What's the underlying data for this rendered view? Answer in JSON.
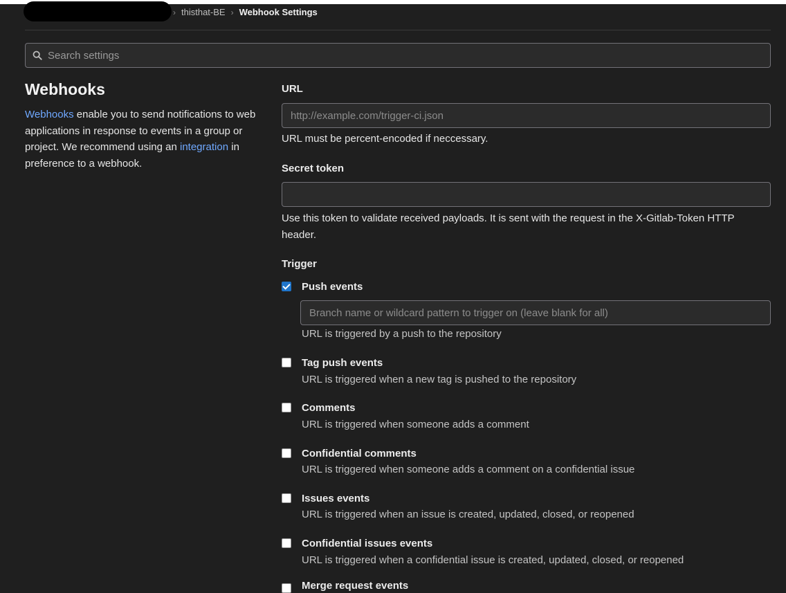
{
  "breadcrumb": {
    "project": "thisthat-BE",
    "current": "Webhook Settings"
  },
  "search": {
    "placeholder": "Search settings"
  },
  "intro": {
    "title": "Webhooks",
    "link_webhooks": "Webhooks",
    "text1": " enable you to send notifications to web applications in response to events in a group or project. We recommend using an ",
    "link_integration": "integration",
    "text2": " in preference to a webhook."
  },
  "form": {
    "url_label": "URL",
    "url_placeholder": "http://example.com/trigger-ci.json",
    "url_help": "URL must be percent-encoded if neccessary.",
    "token_label": "Secret token",
    "token_help": "Use this token to validate received payloads. It is sent with the request in the X-Gitlab-Token HTTP header.",
    "trigger_label": "Trigger",
    "branch_placeholder": "Branch name or wildcard pattern to trigger on (leave blank for all)"
  },
  "triggers": [
    {
      "title": "Push events",
      "desc": "URL is triggered by a push to the repository",
      "checked": true
    },
    {
      "title": "Tag push events",
      "desc": "URL is triggered when a new tag is pushed to the repository",
      "checked": false
    },
    {
      "title": "Comments",
      "desc": "URL is triggered when someone adds a comment",
      "checked": false
    },
    {
      "title": "Confidential comments",
      "desc": "URL is triggered when someone adds a comment on a confidential issue",
      "checked": false
    },
    {
      "title": "Issues events",
      "desc": "URL is triggered when an issue is created, updated, closed, or reopened",
      "checked": false
    },
    {
      "title": "Confidential issues events",
      "desc": "URL is triggered when a confidential issue is created, updated, closed, or reopened",
      "checked": false
    },
    {
      "title": "Merge request events",
      "checked": false
    }
  ]
}
